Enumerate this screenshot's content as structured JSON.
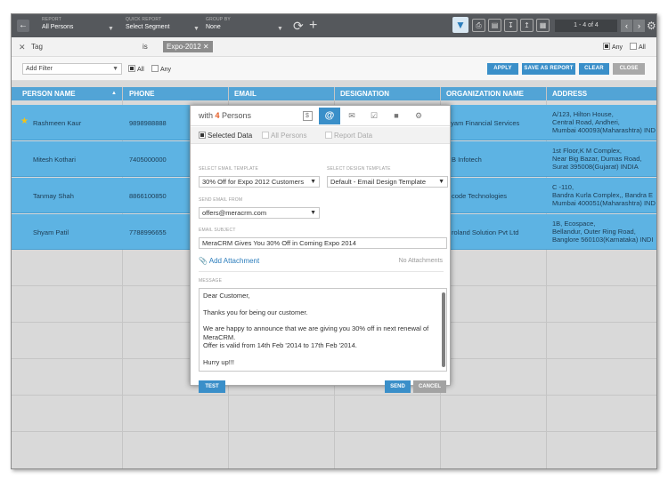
{
  "toolbar": {
    "report_caption": "REPORT",
    "report_value": "All Persons",
    "quick_report_caption": "QUICK REPORT",
    "quick_report_value": "Select Segment",
    "group_by_caption": "GROUP BY",
    "group_by_value": "None",
    "pager_text": "1 - 4 of 4"
  },
  "tag_filter": {
    "field": "Tag",
    "operator": "is",
    "value": "Expo-2012",
    "any_label": "Any",
    "all_label": "All"
  },
  "filter_bar": {
    "add_filter_placeholder": "Add Filter",
    "all_label": "All",
    "any_label": "Any",
    "apply_label": "APPLY",
    "save_report_label": "SAVE AS REPORT",
    "clear_label": "CLEAR",
    "close_label": "CLOSE"
  },
  "table": {
    "headers": [
      "PERSON NAME",
      "PHONE",
      "EMAIL",
      "DESIGNATION",
      "ORGANIZATION NAME",
      "ADDRESS"
    ],
    "rows": [
      {
        "name": "Rashmeen Kaur",
        "phone": "9898988888",
        "org": "Shyam Financial Services",
        "address": [
          "A/123, Hilton House,",
          "Central Road, Andheri,",
          "Mumbai 400093(Maharashtra) IND"
        ]
      },
      {
        "name": "Mitesh Kothari",
        "phone": "7405000000",
        "org": "B Infotech",
        "address": [
          "1st Floor,K M Complex,",
          "Near Big Bazar, Dumas Road,",
          "Surat 395008(Gujarat) INDIA"
        ]
      },
      {
        "name": "Tanmay Shah",
        "phone": "8866100850",
        "org": "code Technologies",
        "address": [
          "C -110,",
          "Bandra Kurla Complex,, Bandra E",
          "Mumbai 400051(Maharashtra) IND"
        ]
      },
      {
        "name": "Shyam Patil",
        "phone": "7788996655",
        "org": "roland Solution Pvt Ltd",
        "address": [
          "1B, Ecospace,",
          "Bellandur, Outer Ring Road,",
          "Banglore 560103(Karnataka) INDI"
        ]
      }
    ]
  },
  "modal": {
    "title_prefix": "with ",
    "title_count": "4",
    "title_suffix": " Persons",
    "opt_selected": "Selected Data",
    "opt_all": "All Persons",
    "opt_report": "Report Data",
    "email_template_caption": "SELECT EMAIL TEMPLATE",
    "email_template_value": "30% Off for Expo 2012 Customers",
    "design_template_caption": "SELECT DESIGN TEMPLATE",
    "design_template_value": "Default - Email Design Template",
    "send_from_caption": "SEND EMAIL FROM",
    "send_from_value": "offers@meracrm.com",
    "subject_caption": "EMAIL SUBJECT",
    "subject_value": "MeraCRM Gives You 30% Off in Coming Expo 2014",
    "add_attachment_label": "Add Attachment",
    "no_attachments_label": "No Attachments",
    "message_caption": "MESSAGE",
    "message_lines": {
      "greeting": "Dear Customer,",
      "thanks": "Thanks you for being our customer.",
      "announce_1": "We are happy to announce that we are giving you 30% off in next renewal of",
      "announce_2": "MeraCRM.",
      "validity": "Offer is valid from 14th Feb '2014 to 17th Feb '2014.",
      "closing": "Hurry up!!!"
    },
    "test_label": "TEST",
    "send_label": "SEND",
    "cancel_label": "CANCEL"
  },
  "colors": {
    "header_blue": "#52a4d6",
    "row_blue": "#5db3e3",
    "button_blue": "#3a8fc9",
    "count_orange": "#e45c25"
  }
}
